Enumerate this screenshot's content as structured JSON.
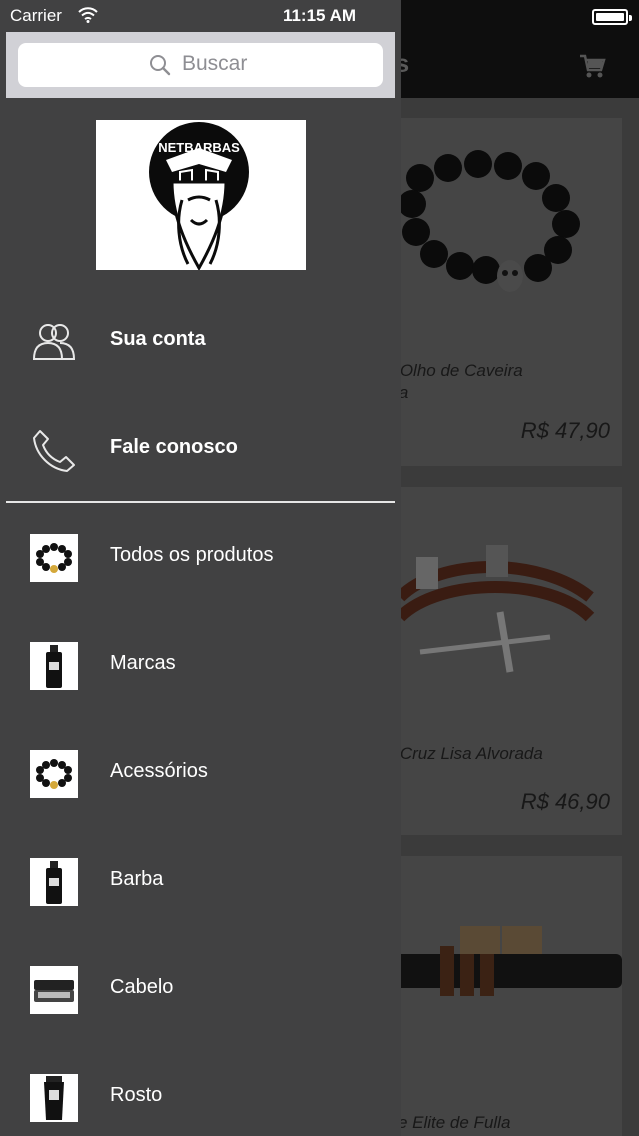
{
  "status_bar": {
    "carrier": "Carrier",
    "time": "11:15 AM"
  },
  "background": {
    "title_fragment": "os",
    "products": [
      {
        "name_line1": "ra Olho de Caveira",
        "name_line2": "oda",
        "price": "R$ 47,90",
        "image": "black-bead-bracelet-skull"
      },
      {
        "name_line1": "ra Cruz Lisa Alvorada",
        "name_line2": "",
        "price": "R$ 46,90",
        "image": "brown-leather-bracelet-cross"
      },
      {
        "name_line1": "lete Elite de Fulla",
        "name_line2": "",
        "price": "",
        "image": "leather-bracelet-metal-clasp"
      }
    ]
  },
  "drawer": {
    "search": {
      "placeholder": "Buscar"
    },
    "logo_text": "NETBARBAS",
    "account_items": [
      {
        "label": "Sua conta",
        "icon": "users-icon"
      },
      {
        "label": "Fale conosco",
        "icon": "phone-icon"
      }
    ],
    "categories": [
      {
        "label": "Todos os produtos",
        "thumb": "bead-bracelet"
      },
      {
        "label": "Marcas",
        "thumb": "beard-oil-bottle"
      },
      {
        "label": "Acessórios",
        "thumb": "bead-bracelet"
      },
      {
        "label": "Barba",
        "thumb": "beard-oil-bottle"
      },
      {
        "label": "Cabelo",
        "thumb": "pomade-tin"
      },
      {
        "label": "Rosto",
        "thumb": "face-cream-tube"
      }
    ]
  },
  "colors": {
    "drawer_bg": "#414142",
    "navbar_bg": "#0e0e0e",
    "search_bar_bg": "#d1d1d6"
  }
}
